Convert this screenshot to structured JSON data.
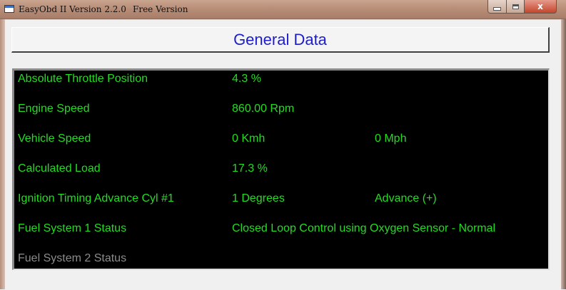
{
  "window": {
    "title": "EasyObd II Version 2.2.0",
    "edition": "Free Version",
    "close_glyph": "x"
  },
  "header": {
    "title": "General Data"
  },
  "rows": [
    {
      "label": "Absolute Throttle Position",
      "value": "4.3 %",
      "extra": ""
    },
    {
      "label": "Engine Speed",
      "value": "860.00 Rpm",
      "extra": ""
    },
    {
      "label": "Vehicle Speed",
      "value": "0 Kmh",
      "extra": "0 Mph"
    },
    {
      "label": "Calculated Load",
      "value": "17.3 %",
      "extra": ""
    },
    {
      "label": "Ignition Timing Advance Cyl #1",
      "value": "1 Degrees",
      "extra": "Advance (+)"
    },
    {
      "label": "Fuel System 1 Status",
      "value": "Closed Loop Control using Oxygen Sensor - Normal",
      "extra": ""
    },
    {
      "label": "Fuel System 2 Status",
      "value": "",
      "extra": ""
    }
  ],
  "colors": {
    "value_text": "#22dd22",
    "disabled_text": "#8c8c8c",
    "title_text": "#1e1ec8",
    "panel_bg": "#000000"
  },
  "icons": {
    "app": "window-icon",
    "minimize": "minimize-icon",
    "maximize": "maximize-icon",
    "close": "close-icon"
  }
}
